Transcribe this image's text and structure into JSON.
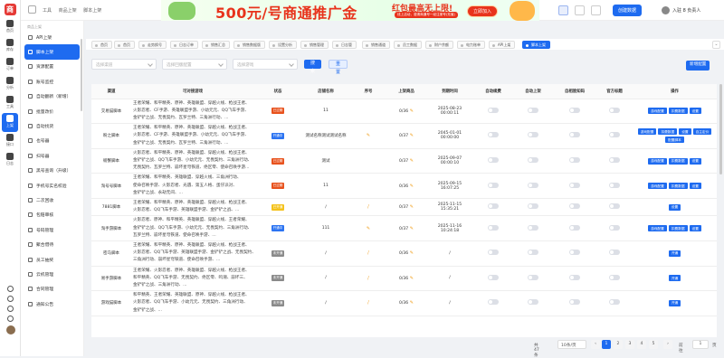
{
  "rail": {
    "items": [
      {
        "label": "首页",
        "icon": "home-icon"
      },
      {
        "label": "库存",
        "icon": "inventory-icon"
      },
      {
        "label": "订单",
        "icon": "order-icon"
      },
      {
        "label": "分析",
        "icon": "analytics-icon"
      },
      {
        "label": "工具",
        "icon": "tools-icon"
      },
      {
        "label": "上架",
        "icon": "listing-icon",
        "active": true
      },
      {
        "label": "接口",
        "icon": "api-icon"
      },
      {
        "label": "日志",
        "icon": "log-icon"
      }
    ]
  },
  "header": {
    "crumbs": [
      "工具",
      "商品上架",
      "脚本上架"
    ],
    "banner": {
      "headline": "500元/号商通推广金",
      "promo": "红包最高无上限!",
      "promo_sub": "线上活动，邀请商通号一经注册号(充值)",
      "cta": "立即加入"
    },
    "new_button": "创建数据",
    "user": "入驻 8 负责人"
  },
  "sidebar": {
    "section_title": "商品上架",
    "items": [
      "API上架",
      "脚本上架",
      "资源配置",
      "账号监控",
      "自动翻新（新增）",
      "批量改价",
      "自动找货",
      "也号器",
      "扫号器",
      "黑号查询（升级）",
      "手机号实名校验",
      "二次回收",
      "包赔审核",
      "号码管理",
      "聚合借待",
      "员工抽奖",
      "云机管理",
      "合同管理",
      "通知公告"
    ],
    "active_index": 1
  },
  "tabs": [
    "首页",
    "首页",
    "走势换号",
    "日志订单",
    "销售汇总",
    "销售数据版",
    "设置分析",
    "销售管理",
    "日志管",
    "销售通道",
    "员工数据",
    "财户余额",
    "电力账单",
    "API上架",
    "脚本上架"
  ],
  "filters": {
    "channel_placeholder": "选择渠道",
    "config_placeholder": "选择回版配置",
    "game_placeholder": "选择游戏",
    "search": "搜索",
    "reset": "重置",
    "add": "新增配置"
  },
  "table": {
    "columns": [
      "渠道",
      "可对接游戏",
      "状态",
      "店铺名称",
      "序号",
      "上架商品",
      "到期时间",
      "自动续费",
      "自动上架",
      "自相验知码",
      "官方标题",
      "操作"
    ],
    "rows": [
      {
        "channel": "交易猫脚本",
        "games": [
          "王者荣耀、和平精英、原神、英雄联盟、穿越火线、枪战王者、",
          "火影忍者、CF手游、英雄联盟手游、小幼元元、QQ飞车手游、",
          "金铲铲之战、无畏契约、瓦罗兰特、三角洲行动、..."
        ],
        "status": "已过期",
        "status_kind": "red",
        "shop": "11",
        "no": "",
        "listed": "0/36",
        "expire": [
          "2025-08-23",
          "00:00:11"
        ],
        "ops": [
          "游戏配置",
          "扣费数据",
          "设置"
        ]
      },
      {
        "channel": "盼之脚本",
        "games": [
          "王者荣耀、和平精英、原神、英雄联盟、穿越火线、枪战王者、",
          "火影忍者、CF手游、英雄联盟手游、小幼元元、QQ飞车手游、",
          "金铲铲之战、无畏契约、瓦罗兰特、三角洲行动、..."
        ],
        "status": "开通中",
        "status_kind": "blue",
        "shop": "测试名称测试测试名称",
        "no": "✎",
        "listed": "0/37",
        "expire": [
          "2045-01-01",
          "00:00:00"
        ],
        "ops": [
          "游戏配置",
          "扣费数据",
          "设置",
          "自主定价",
          "配置脚本"
        ]
      },
      {
        "channel": "螃蟹脚本",
        "games": [
          "火影忍者、和平精英、原神、英雄联盟、穿越火线、枪战王者、",
          "金铲铲之战、QQ飞车手游、小幼元元、无畏契约、三角洲行动、",
          "无畏契约、瓦罗兰特、崩坏星穹铁道、绝区零、使命召唤手游..."
        ],
        "status": "已过期",
        "status_kind": "red",
        "shop": "测试",
        "no": "",
        "listed": "0/37",
        "expire": [
          "2025-09-07",
          "00:00:10"
        ],
        "ops": [
          "游戏配置",
          "扣费数据",
          "设置"
        ]
      },
      {
        "channel": "淘号号脚本",
        "games": [
          "王者荣耀、和平精英、英雄联盟、穿越火线、三角洲行动、",
          "使命召唤手游、火影忍者、光遇、第五人格、蛋仔派对、",
          "金铲铲之战、永劫无间、..."
        ],
        "status": "已过期",
        "status_kind": "red",
        "shop": "11",
        "no": "",
        "listed": "0/36",
        "expire": [
          "2025-09-15",
          "16:07:25"
        ],
        "ops": [
          "游戏配置",
          "扣费数据",
          "设置"
        ]
      },
      {
        "channel": "7881脚本",
        "games": [
          "王者荣耀、和平精英、原神、英雄联盟、穿越火线、枪战王者、",
          "火影忍者、QQ飞车手游、英雄联盟手游、金铲铲之战、..."
        ],
        "status": "已开通",
        "status_kind": "yellow",
        "shop": "/",
        "no": "/",
        "listed": "0/37",
        "expire": [
          "2025-11-15",
          "15:35:21"
        ],
        "ops": [
          "设置"
        ]
      },
      {
        "channel": "淘手游脚本",
        "games": [
          "火影忍者、原神、和平精英、英雄联盟、穿越火线、王者荣耀、",
          "金铲铲之战、QQ飞车手游、小幼元元、无畏契约、三角洲行动、",
          "瓦罗兰特、崩坏星穹铁道、使命召唤手游、..."
        ],
        "status": "开通中",
        "status_kind": "blue",
        "shop": "111",
        "no": "✎",
        "listed": "0/37",
        "expire": [
          "2025-11-16",
          "10:24:18"
        ],
        "ops": [
          "游戏配置",
          "扣费数据",
          "设置"
        ]
      },
      {
        "channel": "密马脚本",
        "games": [
          "王者荣耀、和平精英、原神、英雄联盟、穿越火线、枪战王者、",
          "火影忍者、QQ飞车手游、英雄联盟手游、金铲铲之战、无畏契约、",
          "三角洲行动、崩坏星穹铁道、使命召唤手游、..."
        ],
        "status": "未开通",
        "status_kind": "gray",
        "shop": "/",
        "no": "/",
        "listed": "0/36",
        "expire": [
          "/"
        ],
        "ops": [
          "开通"
        ]
      },
      {
        "channel": "易手游脚本",
        "games": [
          "王者荣耀、火影忍者、原神、英雄联盟、穿越火线、枪战王者、",
          "和平精英、QQ飞车手游、无畏契约、绝区零、鸣潮、崩坏三、",
          "金铲铲之战、三角洲行动、..."
        ],
        "status": "未开通",
        "status_kind": "gray",
        "shop": "/",
        "no": "/",
        "listed": "0/36",
        "expire": [
          "/"
        ],
        "ops": [
          "开通"
        ]
      },
      {
        "channel": "游戏猫脚本",
        "games": [
          "和平精英、王者荣耀、英雄联盟、原神、穿越火线、枪战王者、",
          "火影忍者、QQ飞车手游、小幼元元、无畏契约、三角洲行动、",
          "金铲铲之战、..."
        ],
        "status": "未开通",
        "status_kind": "gray",
        "shop": "/",
        "no": "/",
        "listed": "0/36",
        "expire": [
          "/"
        ],
        "ops": [
          "开通"
        ]
      }
    ]
  },
  "pager": {
    "total": "共 47 条",
    "size": "10条/页",
    "pages": [
      "1",
      "2",
      "3",
      "4",
      "5"
    ],
    "current": "1",
    "goto": "前往",
    "goto_value": "1",
    "page_word": "页"
  }
}
